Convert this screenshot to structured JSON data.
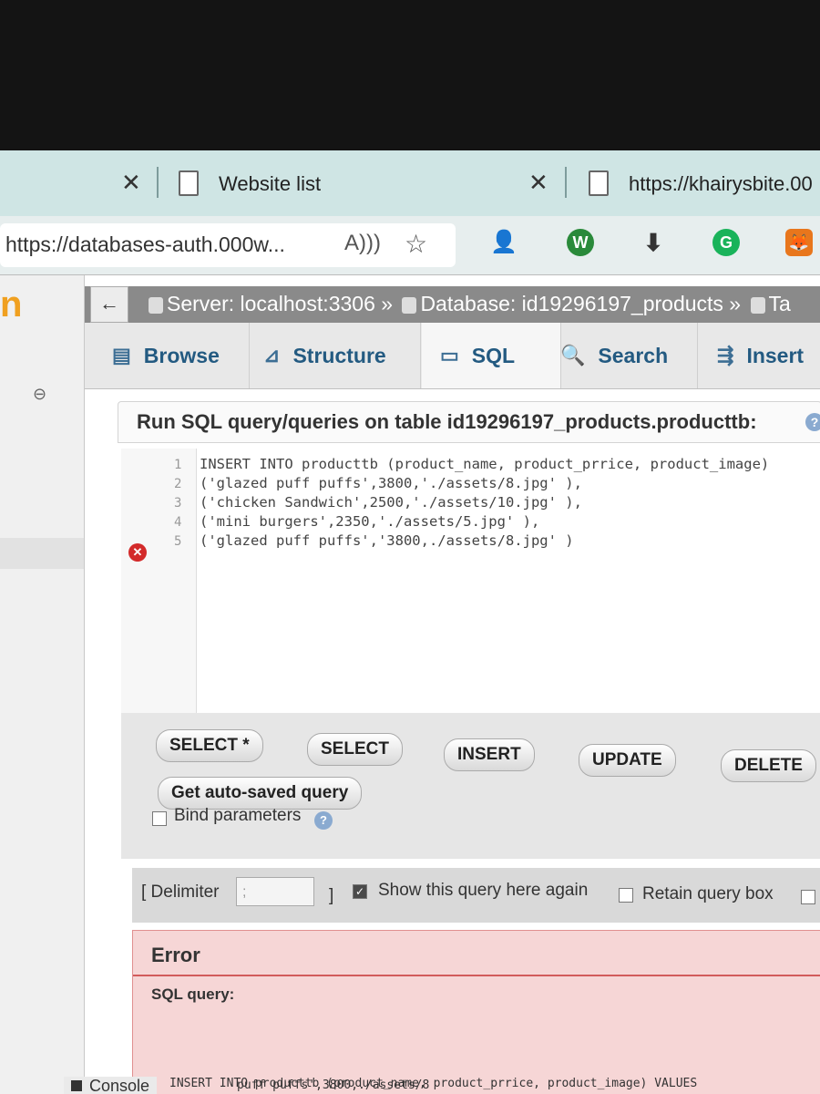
{
  "browser": {
    "tabs": [
      {
        "title": "Website list"
      },
      {
        "title": "https://khairysbite.00"
      }
    ],
    "url": "https://databases-auth.000w...",
    "read_aloud_icon": "A",
    "extensions": [
      "profile-sync-icon",
      "w-extension-icon",
      "download-icon",
      "grammarly-icon",
      "metamask-icon"
    ]
  },
  "nav": {
    "logo_fragment": "n"
  },
  "breadcrumb": {
    "back": "←",
    "server": "Server: localhost:3306 »",
    "database": "Database: id19296197_products »",
    "table_fragment": "Ta"
  },
  "tabs": {
    "browse": "Browse",
    "structure": "Structure",
    "sql": "SQL",
    "search": "Search",
    "insert": "Insert"
  },
  "panel": {
    "title": "Run SQL query/queries on table id19296197_products.producttb:"
  },
  "editor": {
    "line_numbers": [
      "1",
      "2",
      "3",
      "4",
      "5"
    ],
    "lines": [
      "INSERT INTO producttb (product_name, product_prrice, product_image)",
      "('glazed puff puffs',3800,'./assets/8.jpg' ),",
      "('chicken Sandwich',2500,'./assets/10.jpg' ),",
      "('mini burgers',2350,'./assets/5.jpg' ),",
      "('glazed puff puffs','3800,./assets/8.jpg' )"
    ],
    "error_line": "5"
  },
  "buttons": {
    "select_star": "SELECT *",
    "select": "SELECT",
    "insert": "INSERT",
    "update": "UPDATE",
    "delete": "DELETE",
    "autosaved": "Get auto-saved query"
  },
  "options": {
    "bind_parameters": "Bind parameters",
    "delimiter_open": "[ Delimiter",
    "delimiter_value": ";",
    "delimiter_close": "]",
    "show_query_again": "Show this query here again",
    "show_query_again_checked": true,
    "retain_query_box": "Retain query box",
    "retain_query_box_checked": false
  },
  "error": {
    "title": "Error",
    "sql_query_label": "SQL query:",
    "query_excerpt": "INSERT INTO producttb (product_name, product_prrice, product_image) VALUES"
  },
  "console": {
    "label": "Console",
    "excerpt": "puff puffs',3800,./assets/8"
  }
}
